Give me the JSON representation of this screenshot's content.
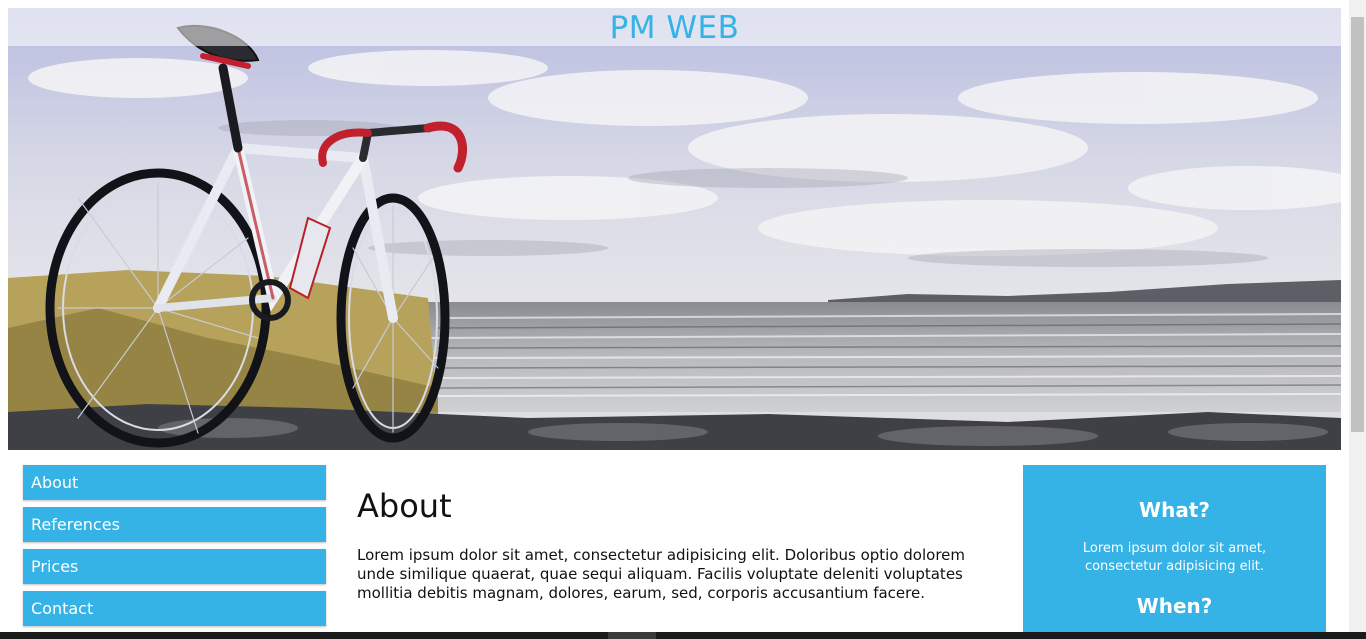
{
  "header": {
    "title": "PM WEB",
    "hero_image": "bicycle-by-the-sea-painting"
  },
  "nav": {
    "items": [
      {
        "label": "About"
      },
      {
        "label": "References"
      },
      {
        "label": "Prices"
      },
      {
        "label": "Contact"
      }
    ]
  },
  "main": {
    "heading": "About",
    "paragraph": "Lorem ipsum dolor sit amet, consectetur adipisicing elit. Doloribus optio dolorem unde similique quaerat, quae sequi aliquam. Facilis voluptate deleniti voluptates mollitia debitis magnam, dolores, earum, sed, corporis accusantium facere."
  },
  "aside": {
    "what_heading": "What?",
    "what_text": "Lorem ipsum dolor sit amet, consectetur adipisicing elit.",
    "when_heading": "When?"
  },
  "colors": {
    "accent": "#35b2e6",
    "text": "#111111",
    "background": "#ffffff"
  }
}
